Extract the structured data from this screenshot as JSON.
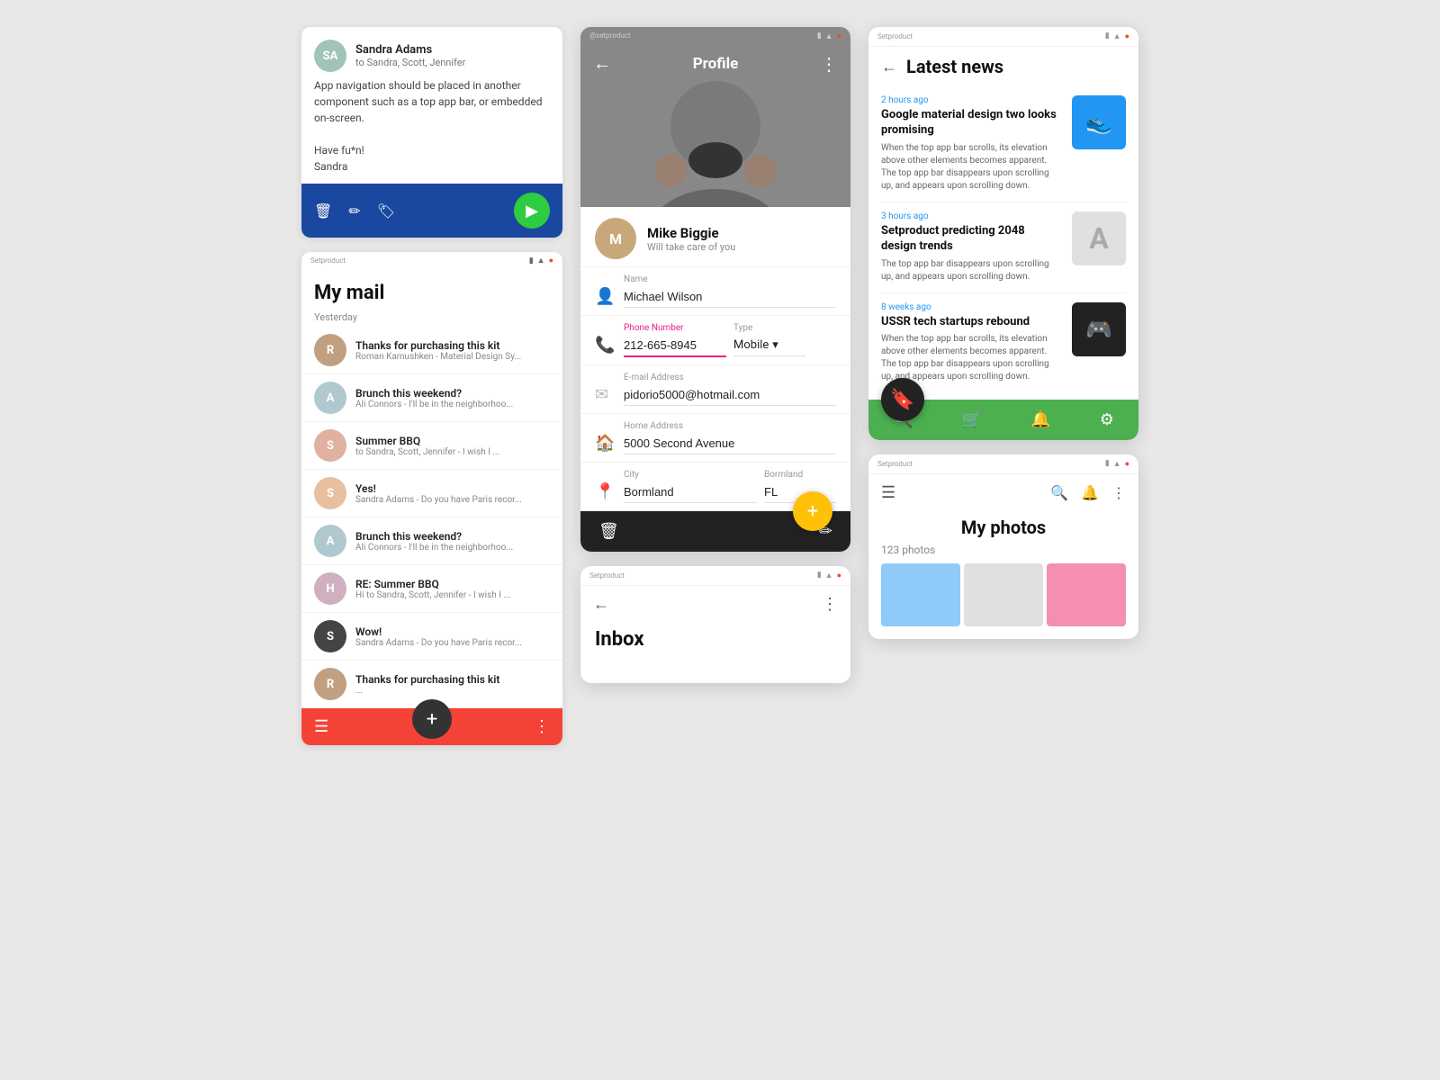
{
  "email_top": {
    "sender": "Sandra Adams",
    "recipients": "to Sandra, Scott, Jennifer",
    "body_line1": "App navigation should be placed in another",
    "body_line2": "component such as a top app bar, or embedded",
    "body_line3": "on-screen.",
    "body_line4": "",
    "body_line5": "Have fu*n!",
    "body_line6": "Sandra",
    "avatar_initials": "SA",
    "avatar_color": "#a0c4b8"
  },
  "my_mail": {
    "title": "My mail",
    "section": "Yesterday",
    "items": [
      {
        "subject": "Thanks for purchasing this kit",
        "preview": "Roman Kamushken - Material Design Sy...",
        "avatar_color": "#c0a080"
      },
      {
        "subject": "Brunch this weekend?",
        "preview": "Ali Connors - I'll be in the neighborhoo...",
        "avatar_color": "#b0c8d0"
      },
      {
        "subject": "Summer BBQ",
        "preview": "to Sandra, Scott, Jennifer - I wish I ...",
        "avatar_color": "#e0b0a0"
      },
      {
        "subject": "Yes!",
        "preview": "Sandra Adams - Do you have Paris recor...",
        "avatar_color": "#e8c0a0"
      },
      {
        "subject": "Brunch this weekend?",
        "preview": "Ali Connors - I'll be in the neighborhoo...",
        "avatar_color": "#b0c8d0"
      },
      {
        "subject": "RE: Summer BBQ",
        "preview": "Hi to Sandra, Scott, Jennifer - I wish I ...",
        "avatar_color": "#d0b0c0"
      },
      {
        "subject": "Wow!",
        "preview": "Sandra Adams - Do you have Paris recor...",
        "avatar_color": "#444"
      },
      {
        "subject": "Thanks for purchasing this kit",
        "preview": "...",
        "avatar_color": "#c0a080"
      }
    ]
  },
  "profile": {
    "brand": "@setproduct",
    "title": "Profile",
    "user_name": "Mike Biggie",
    "user_subtitle": "Will take care of you",
    "name_label": "Name",
    "name_value": "Michael Wilson",
    "phone_label": "Phone Number",
    "phone_value": "212-665-8945",
    "type_label": "Type",
    "type_value": "Mobile",
    "email_label": "E-mail Address",
    "email_value": "pidorio5000@hotmail.com",
    "address_label": "Home Address",
    "address_value": "5000 Second Avenue",
    "city_label": "City",
    "city_value": "Bormland",
    "state_label": "Bormland",
    "state_value": "FL"
  },
  "inbox": {
    "brand": "Setproduct",
    "title": "Inbox"
  },
  "latest_news": {
    "brand": "Setproduct",
    "title": "Latest news",
    "items": [
      {
        "time": "2 hours ago",
        "headline": "Google material design two looks promising",
        "body": "When the top app bar scrolls, its elevation above other elements becomes apparent. The top app bar disappears upon scrolling up, and appears upon scrolling down.",
        "thumb_type": "blue",
        "thumb_icon": "👟"
      },
      {
        "time": "3 hours ago",
        "headline": "Setproduct predicting 2048 design trends",
        "body": "The top app bar disappears upon scrolling up, and appears upon scrolling down.",
        "thumb_type": "gray",
        "thumb_icon": "A"
      },
      {
        "time": "8 weeks ago",
        "headline": "USSR tech startups rebound",
        "body": "When the top app bar scrolls, its elevation above other elements becomes apparent. The top app bar disappears upon scrolling up, and appears upon scrolling down.",
        "thumb_type": "dark",
        "thumb_icon": "🎮"
      }
    ]
  },
  "my_photos": {
    "brand": "Setproduct",
    "title": "My photos",
    "count": "123 photos"
  },
  "icons": {
    "back": "←",
    "more": "⋮",
    "delete": "🗑",
    "edit": "✏",
    "label": "🏷",
    "send": "▶",
    "menu": "☰",
    "search": "🔍",
    "more_vert": "⋮",
    "add": "+",
    "phone": "📞",
    "email": "✉",
    "home": "🏠",
    "location": "📍",
    "person": "👤",
    "bookmark": "🔖",
    "cart": "🛒",
    "bell": "🔔",
    "settings": "⚙",
    "wifi": "▲",
    "battery": "▮",
    "signal": "◉"
  }
}
